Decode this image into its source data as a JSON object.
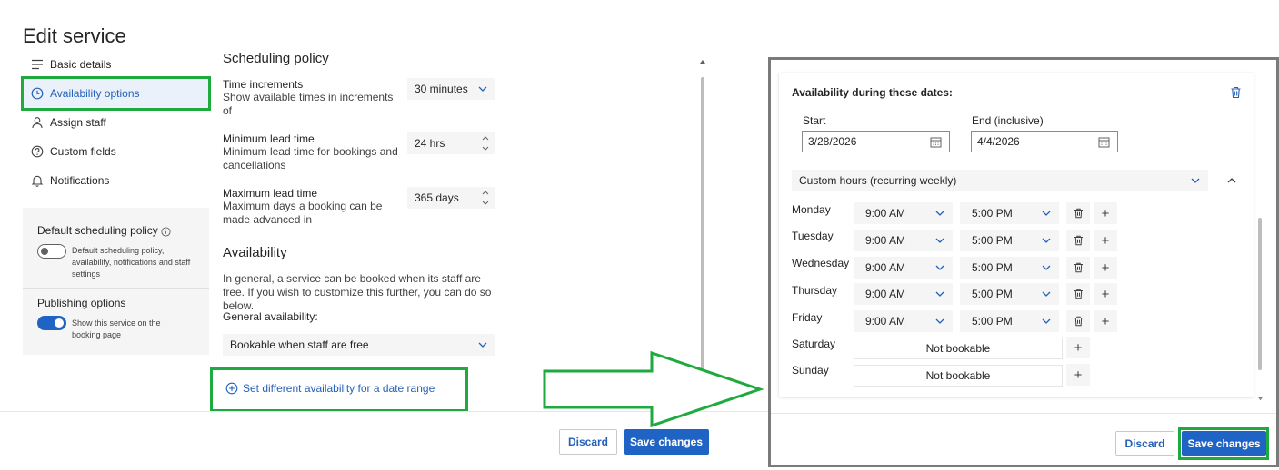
{
  "page": {
    "title": "Edit service"
  },
  "nav": [
    {
      "label": "Basic details",
      "icon": "list-icon"
    },
    {
      "label": "Availability options",
      "icon": "clock-icon",
      "active": true
    },
    {
      "label": "Assign staff",
      "icon": "person-icon"
    },
    {
      "label": "Custom fields",
      "icon": "question-circle-icon"
    },
    {
      "label": "Notifications",
      "icon": "bell-icon"
    }
  ],
  "default_policy": {
    "title": "Default scheduling policy",
    "description": "Default scheduling policy, availability, notifications and staff settings",
    "enabled": false
  },
  "publishing": {
    "title": "Publishing options",
    "description": "Show this service on the booking page",
    "enabled": true
  },
  "scheduling": {
    "heading": "Scheduling policy",
    "time_increments": {
      "label": "Time increments",
      "sub": "Show available times in increments of",
      "value": "30 minutes"
    },
    "min_lead": {
      "label": "Minimum lead time",
      "sub": "Minimum lead time for bookings and cancellations",
      "value": "24 hrs"
    },
    "max_lead": {
      "label": "Maximum lead time",
      "sub": "Maximum days a booking can be made advanced in",
      "value": "365 days"
    }
  },
  "availability": {
    "heading": "Availability",
    "description": "In general, a service can be booked when its staff are free. If you wish to customize this further, you can do so below.",
    "general_label": "General availability:",
    "general_value": "Bookable when staff are free",
    "date_range_link": "Set different availability for a date range"
  },
  "footer_left": {
    "discard": "Discard",
    "save": "Save changes"
  },
  "date_range": {
    "heading": "Availability during these dates:",
    "start_label": "Start",
    "start_value": "3/28/2026",
    "end_label": "End (inclusive)",
    "end_value": "4/4/2026",
    "hours_mode": "Custom hours (recurring weekly)",
    "days": [
      {
        "name": "Monday",
        "start": "9:00 AM",
        "end": "5:00 PM",
        "bookable": true
      },
      {
        "name": "Tuesday",
        "start": "9:00 AM",
        "end": "5:00 PM",
        "bookable": true
      },
      {
        "name": "Wednesday",
        "start": "9:00 AM",
        "end": "5:00 PM",
        "bookable": true
      },
      {
        "name": "Thursday",
        "start": "9:00 AM",
        "end": "5:00 PM",
        "bookable": true
      },
      {
        "name": "Friday",
        "start": "9:00 AM",
        "end": "5:00 PM",
        "bookable": true
      },
      {
        "name": "Saturday",
        "text": "Not bookable",
        "bookable": false
      },
      {
        "name": "Sunday",
        "text": "Not bookable",
        "bookable": false
      }
    ]
  },
  "footer_right": {
    "discard": "Discard",
    "save": "Save changes"
  },
  "colors": {
    "accent": "#1f64c4",
    "highlight": "#1faa3f",
    "link": "#2461b8"
  }
}
